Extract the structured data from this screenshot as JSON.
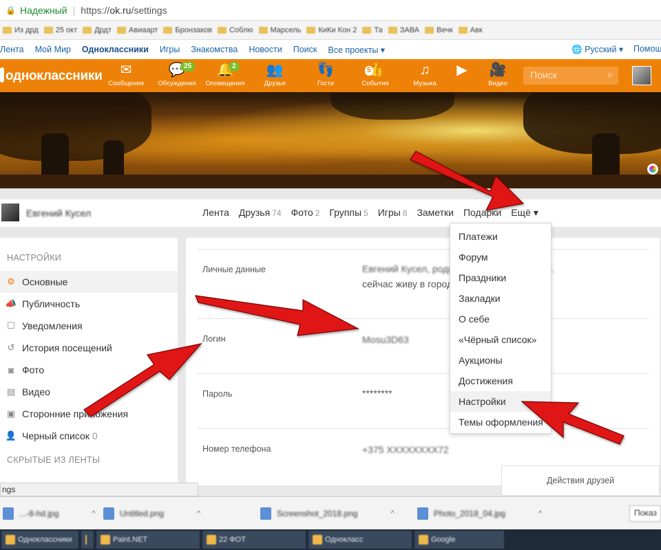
{
  "browser": {
    "secure_label": "Надежный",
    "url_scheme": "https://",
    "url_host": "ok.ru",
    "url_path": "/settings",
    "bookmarks": [
      "Из дрд",
      "25 окт",
      "Дрдт",
      "Авиаарт",
      "Бронзаков",
      "Соблю",
      "Марсель",
      "КиКи Кон 2",
      "Та",
      "ЗАВА",
      "Вечк",
      "Авк"
    ],
    "status_text": "ngs"
  },
  "ok_topnav": {
    "items": [
      "Лента",
      "Мой Мир",
      "Одноклассники",
      "Игры",
      "Знакомства",
      "Новости",
      "Поиск",
      "Все проекты ▾"
    ],
    "active_index": 2,
    "language": "Русский ▾",
    "help": "Помощ"
  },
  "header": {
    "logo": "одноклассники",
    "nav": [
      {
        "icon": "envelope-icon",
        "glyph": "✉",
        "label": "Сообщения"
      },
      {
        "icon": "discussions-icon",
        "glyph": "💬",
        "label": "Обсуждения",
        "badge": "25"
      },
      {
        "icon": "bell-icon",
        "glyph": "🔔",
        "label": "Оповещения",
        "badge": "2"
      },
      {
        "icon": "friends-icon",
        "glyph": "👥",
        "label": "Друзья"
      },
      {
        "icon": "footprints-icon",
        "glyph": "👣",
        "label": "Гости"
      },
      {
        "icon": "events-icon",
        "glyph": "👍",
        "label": "События",
        "badge_small": "5"
      },
      {
        "icon": "music-icon",
        "glyph": "♫",
        "label": "Музыка"
      },
      {
        "icon": "play-icon",
        "glyph": "▶",
        "label": ""
      },
      {
        "icon": "video-camera-icon",
        "glyph": "🎥",
        "label": "Видео"
      }
    ],
    "search_placeholder": "Поиск"
  },
  "profile": {
    "name": "Евгений Кусел",
    "tabs": [
      {
        "label": "Лента",
        "count": ""
      },
      {
        "label": "Друзья",
        "count": "74"
      },
      {
        "label": "Фото",
        "count": "2"
      },
      {
        "label": "Группы",
        "count": "5"
      },
      {
        "label": "Игры",
        "count": "8"
      },
      {
        "label": "Заметки",
        "count": ""
      },
      {
        "label": "Подарки",
        "count": ""
      },
      {
        "label": "Ещё ▾",
        "count": ""
      }
    ]
  },
  "more_menu": {
    "items": [
      "Платежи",
      "Форум",
      "Праздники",
      "Закладки",
      "О себе",
      "«Чёрный список»",
      "Аукционы",
      "Достижения",
      "Настройки",
      "Темы оформления"
    ],
    "highlighted_index": 8
  },
  "sidebar": {
    "header1": "НАСТРОЙКИ",
    "items": [
      {
        "icon": "gear-icon",
        "glyph": "⚙",
        "label": "Основные",
        "count": ""
      },
      {
        "icon": "megaphone-icon",
        "glyph": "📣",
        "label": "Публичность",
        "count": ""
      },
      {
        "icon": "notification-icon",
        "glyph": "☐",
        "label": "Уведомления",
        "count": ""
      },
      {
        "icon": "history-icon",
        "glyph": "↺",
        "label": "История посещений",
        "count": ""
      },
      {
        "icon": "camera-icon",
        "glyph": "◙",
        "label": "Фото",
        "count": ""
      },
      {
        "icon": "film-icon",
        "glyph": "▤",
        "label": "Видео",
        "count": ""
      },
      {
        "icon": "apps-icon",
        "glyph": "▣",
        "label": "Сторонние приложения",
        "count": ""
      },
      {
        "icon": "block-user-icon",
        "glyph": "👤",
        "label": "Черный список",
        "count": "0"
      }
    ],
    "active_index": 0,
    "header2": "СКРЫТЫЕ ИЗ ЛЕНТЫ"
  },
  "settings": {
    "rows": [
      {
        "label": "Личные данные",
        "value_line1": "Евгений Кусел, родился в городе Могилев.",
        "value_line2": "сейчас живу в городе",
        "blurred": true
      },
      {
        "label": "Логин",
        "value_line1": "Mosu3D63",
        "value_line2": "",
        "blurred": true
      },
      {
        "label": "Пароль",
        "value_line1": "********",
        "value_line2": "",
        "blurred": false
      },
      {
        "label": "Номер телефона",
        "value_line1": "+375 XXXXXXXX72",
        "value_line2": "",
        "blurred": true
      }
    ]
  },
  "friends_actions": "Действия друзей",
  "downloads": [
    {
      "name": "...-8-hd.jpg"
    },
    {
      "name": "Untitled.png"
    },
    {
      "name": "Screenshot_2018.png"
    },
    {
      "name": "Photo_2018_04.jpg"
    }
  ],
  "downloads_show_all": "Показ",
  "taskbar": [
    "Одноклассники",
    "",
    "Paint.NET",
    "22 ФОТ",
    "Однокласс",
    "Google"
  ],
  "colors": {
    "ok_orange": "#ee8208",
    "badge_green": "#7bbd2c",
    "link_blue": "#1a64a6",
    "arrow_red": "#e01818"
  }
}
